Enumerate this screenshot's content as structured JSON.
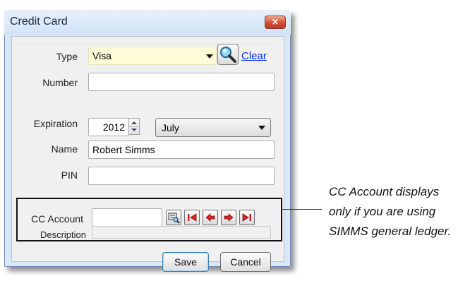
{
  "window": {
    "title": "Credit Card",
    "close_glyph": "×"
  },
  "form": {
    "type": {
      "label": "Type",
      "value": "Visa"
    },
    "lookup_icon": "magnifier-icon",
    "clear_link": "Clear",
    "number": {
      "label": "Number",
      "value": ""
    },
    "expiration": {
      "label": "Expiration",
      "year": "2012",
      "month": "July"
    },
    "name": {
      "label": "Name",
      "value": "Robert Simms"
    },
    "pin": {
      "label": "PIN",
      "value": ""
    },
    "cc_account": {
      "label": "CC Account",
      "value": ""
    },
    "description": {
      "label": "Description",
      "value": ""
    }
  },
  "nav_buttons": [
    "lookup-record-icon",
    "first-record-icon",
    "previous-record-icon",
    "next-record-icon",
    "last-record-icon"
  ],
  "buttons": {
    "save": "Save",
    "cancel": "Cancel"
  },
  "callout": {
    "lines": [
      "CC Account displays",
      "only if you are using",
      "SIMMS general ledger."
    ]
  },
  "colors": {
    "yellow_field": "#fffcd8",
    "link_blue": "#0033ee",
    "nav_red": "#d82424"
  }
}
